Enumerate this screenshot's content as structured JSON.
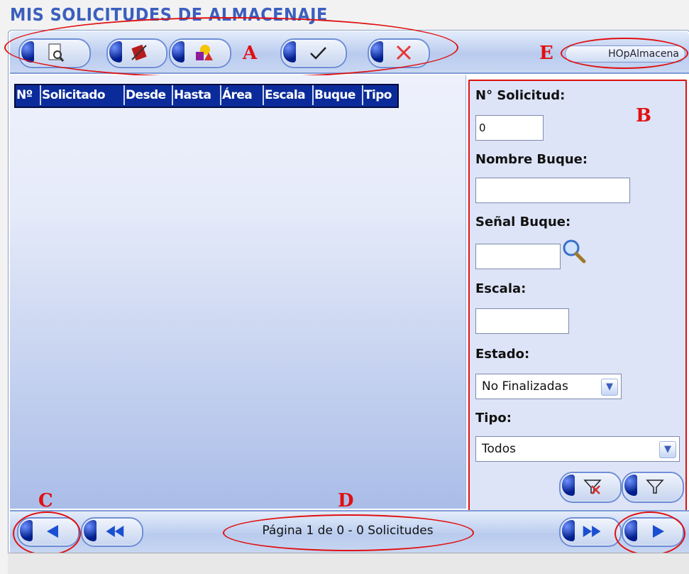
{
  "title": "MIS SOLICITUDES DE ALMACENAJE",
  "toolbar": {
    "buttons": [
      {
        "name": "preview-icon"
      },
      {
        "name": "edit-icon"
      },
      {
        "name": "shapes-icon"
      },
      {
        "name": "check-icon"
      },
      {
        "name": "cancel-icon"
      }
    ],
    "user": "HOpAlmacena"
  },
  "annotations": {
    "A": "A",
    "B": "B",
    "C": "C",
    "D": "D",
    "E": "E"
  },
  "grid": {
    "columns": [
      "Nº",
      "Solicitado",
      "Desde",
      "Hasta",
      "Área",
      "Escala",
      "Buque",
      "Tipo"
    ]
  },
  "filters": {
    "solicitud_label": "N° Solicitud:",
    "solicitud_value": "0",
    "nombre_label": "Nombre Buque:",
    "nombre_value": "",
    "senal_label": "Señal Buque:",
    "senal_value": "",
    "escala_label": "Escala:",
    "escala_value": "",
    "estado_label": "Estado:",
    "estado_value": "No Finalizadas",
    "tipo_label": "Tipo:",
    "tipo_value": "Todos"
  },
  "pager": {
    "info": "Página 1 de 0 - 0 Solicitudes"
  },
  "colors": {
    "accent": "#0b2b9a",
    "annotation": "#e01010"
  }
}
